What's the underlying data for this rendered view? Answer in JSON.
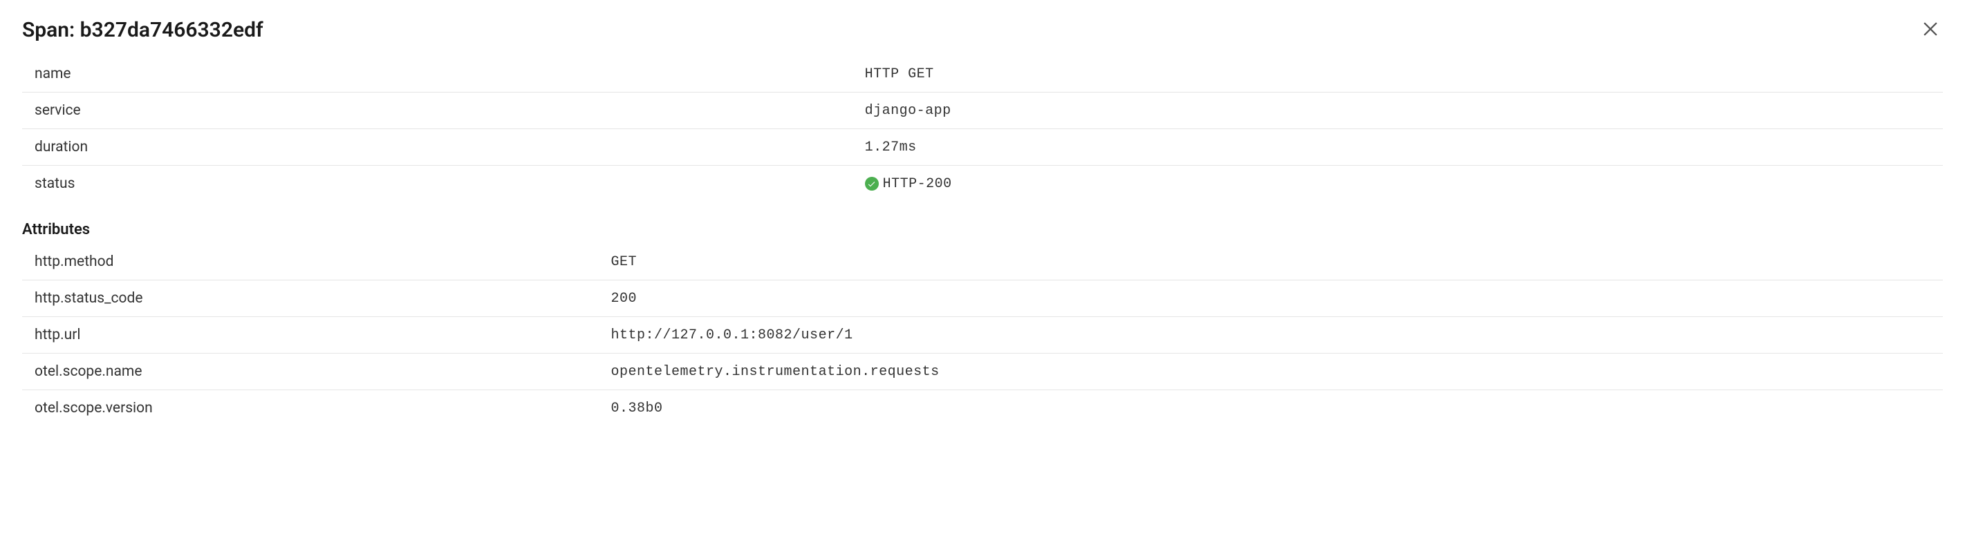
{
  "header": {
    "title": "Span: b327da7466332edf"
  },
  "summary": {
    "rows": [
      {
        "key": "name",
        "value": "HTTP GET"
      },
      {
        "key": "service",
        "value": "django-app"
      },
      {
        "key": "duration",
        "value": "1.27ms"
      },
      {
        "key": "status",
        "value": "HTTP-200",
        "status_ok": true
      }
    ]
  },
  "attributes": {
    "title": "Attributes",
    "rows": [
      {
        "key": "http.method",
        "value": "GET"
      },
      {
        "key": "http.status_code",
        "value": "200"
      },
      {
        "key": "http.url",
        "value": "http://127.0.0.1:8082/user/1"
      },
      {
        "key": "otel.scope.name",
        "value": "opentelemetry.instrumentation.requests"
      },
      {
        "key": "otel.scope.version",
        "value": "0.38b0"
      }
    ]
  }
}
